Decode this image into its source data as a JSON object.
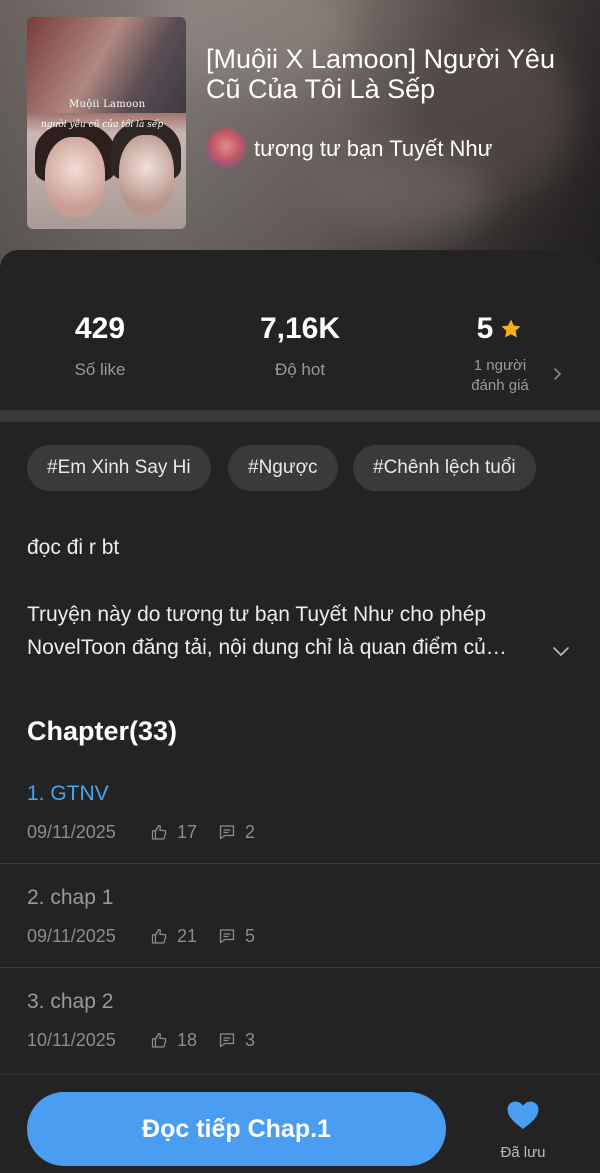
{
  "book": {
    "title": "[Muộii X Lamoon] Người Yêu Cũ Của Tôi Là Sếp",
    "cover_text_top": "Muộii Lamoon",
    "cover_text_sub": "người yêu cũ của tôi là sếp",
    "author": "tương tư bạn Tuyết Như"
  },
  "stats": {
    "likes": {
      "value": "429",
      "label": "Số like"
    },
    "hot": {
      "value": "7,16K",
      "label": "Độ hot"
    },
    "rating": {
      "value": "5",
      "label_line1": "1 người",
      "label_line2": "đánh giá",
      "star_color": "#f5b01a"
    }
  },
  "tags": [
    "#Em Xinh Say Hi",
    "#Ngược",
    "#Chênh lệch tuổi"
  ],
  "description": {
    "line1": "đọc đi r bt",
    "para_line1": "Truyện này do tương tư bạn Tuyết Như cho phép",
    "para_line2": "NovelToon đăng tải, nội dung chỉ là quan điểm củ…"
  },
  "chapters": {
    "heading": "Chapter(33)",
    "items": [
      {
        "name": "1. GTNV",
        "date": "09/11/2025",
        "likes": "17",
        "comments": "2",
        "active": true
      },
      {
        "name": "2. chap 1",
        "date": "09/11/2025",
        "likes": "21",
        "comments": "5",
        "active": false
      },
      {
        "name": "3. chap 2",
        "date": "10/11/2025",
        "likes": "18",
        "comments": "3",
        "active": false
      }
    ]
  },
  "bottom": {
    "read_button": "Đọc tiếp Chap.1",
    "save_label": "Đã lưu",
    "accent": "#4a9df0"
  }
}
